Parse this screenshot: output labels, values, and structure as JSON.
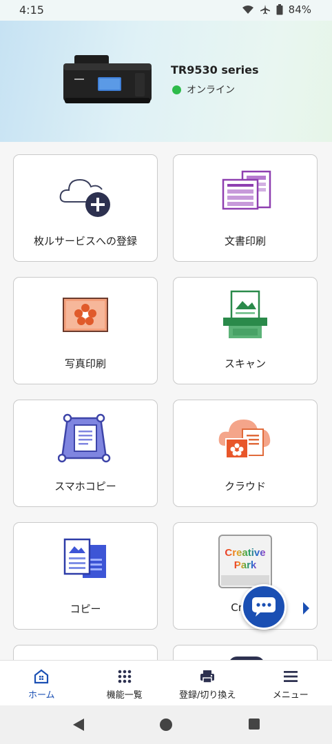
{
  "status_bar": {
    "time": "4:15",
    "battery": "84%"
  },
  "printer": {
    "name": "TR9530 series",
    "status": "オンライン",
    "status_color": "#2dbb4a"
  },
  "tiles": [
    {
      "label": "枚ルサービスへの登録",
      "icon": "cloud-plus-icon"
    },
    {
      "label": "文書印刷",
      "icon": "document-print-icon"
    },
    {
      "label": "写真印刷",
      "icon": "photo-print-icon"
    },
    {
      "label": "スキャン",
      "icon": "scan-icon"
    },
    {
      "label": "スマホコピー",
      "icon": "smartphone-copy-icon"
    },
    {
      "label": "クラウド",
      "icon": "cloud-icon"
    },
    {
      "label": "コピー",
      "icon": "copy-icon"
    },
    {
      "label": "Creati",
      "icon": "creative-park-icon",
      "logo_line1": "Creative",
      "logo_line2": "Park"
    }
  ],
  "nav": [
    {
      "label": "ホーム",
      "icon": "home-icon"
    },
    {
      "label": "機能一覧",
      "icon": "grid-icon"
    },
    {
      "label": "登録/切り換え",
      "icon": "printer-icon"
    },
    {
      "label": "メニュー",
      "icon": "menu-icon"
    }
  ],
  "colors": {
    "accent": "#1a4fb3",
    "online": "#2dbb4a"
  }
}
